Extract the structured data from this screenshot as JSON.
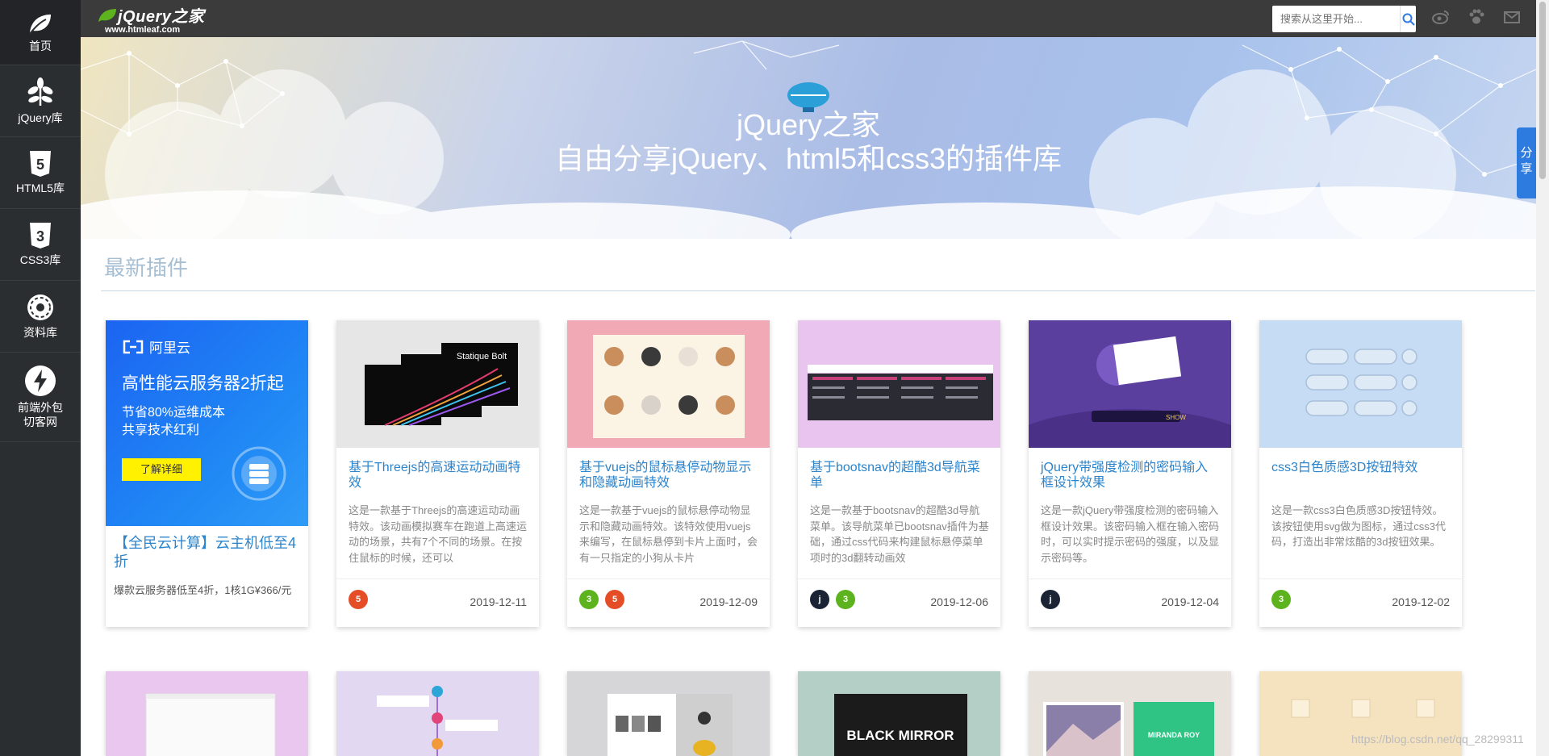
{
  "sidebar": {
    "items": [
      {
        "label": "首页",
        "icon": "leaf-icon"
      },
      {
        "label": "jQuery库",
        "icon": "plant-icon"
      },
      {
        "label": "HTML5库",
        "icon": "html5-icon"
      },
      {
        "label": "CSS3库",
        "icon": "css3-icon"
      },
      {
        "label": "资料库",
        "icon": "empire-icon"
      },
      {
        "label": "前端外包\n切客网",
        "icon": "lightning-icon"
      }
    ]
  },
  "header": {
    "logo_title": "jQuery之家",
    "logo_sub": "www.htmleaf.com",
    "search_placeholder": "搜索从这里开始...",
    "icons": [
      "weibo-icon",
      "paw-icon",
      "mail-icon"
    ]
  },
  "banner": {
    "title": "jQuery之家",
    "subtitle": "自由分享jQuery、html5和css3的插件库"
  },
  "share_label": "分享",
  "section": {
    "title": "最新插件"
  },
  "ad": {
    "brand": "阿里云",
    "headline": "高性能云服务器2折起",
    "line1": "节省80%运维成本",
    "line2": "共享技术红利",
    "button": "了解详细",
    "title": "【全民云计算】云主机低至4折",
    "desc": "爆款云服务器低至4折，1核1G¥366/元"
  },
  "cards": [
    {
      "title": "基于Threejs的高速运动动画特效",
      "desc": "这是一款基于Threejs的高速运动动画特效。该动画模拟赛车在跑道上高速运动的场景，共有7个不同的场景。在按住鼠标的时候，还可以",
      "date": "2019-12-11",
      "badges": [
        "html5"
      ],
      "thumb_text": "Statique Bolt"
    },
    {
      "title": "基于vuejs的鼠标悬停动物显示和隐藏动画特效",
      "desc": "这是一款基于vuejs的鼠标悬停动物显示和隐藏动画特效。该特效使用vuejs来编写，在鼠标悬停到卡片上面时，会有一只指定的小狗从卡片",
      "date": "2019-12-09",
      "badges": [
        "css3",
        "html5"
      ],
      "thumb_text": ""
    },
    {
      "title": "基于bootsnav的超酷3d导航菜单",
      "desc": "这是一款基于bootsnav的超酷3d导航菜单。该导航菜单已bootsnav插件为基础，通过css代码来构建鼠标悬停菜单项时的3d翻转动画效",
      "date": "2019-12-06",
      "badges": [
        "jq",
        "css3"
      ],
      "thumb_text": ""
    },
    {
      "title": "jQuery带强度检测的密码输入框设计效果",
      "desc": "这是一款jQuery带强度检测的密码输入框设计效果。该密码输入框在输入密码时，可以实时提示密码的强度，以及显示密码等。",
      "date": "2019-12-04",
      "badges": [
        "jq"
      ],
      "thumb_text": "SHOW"
    },
    {
      "title": "css3白色质感3D按钮特效",
      "desc": "这是一款css3白色质感3D按钮特效。该按钮使用svg做为图标，通过css3代码，打造出非常炫酷的3d按钮效果。",
      "date": "2019-12-02",
      "badges": [
        "css3"
      ],
      "thumb_text": ""
    }
  ],
  "row2_thumb_text": [
    "",
    "",
    "",
    "BLACK MIRROR",
    "MIRANDA ROY",
    ""
  ],
  "watermark": "https://blog.csdn.net/qq_28299311",
  "colors": {
    "sidebar": "#2b2e31",
    "topbar": "#3b3b3b",
    "link": "#2c84cc",
    "accent": "#2e7be0"
  }
}
